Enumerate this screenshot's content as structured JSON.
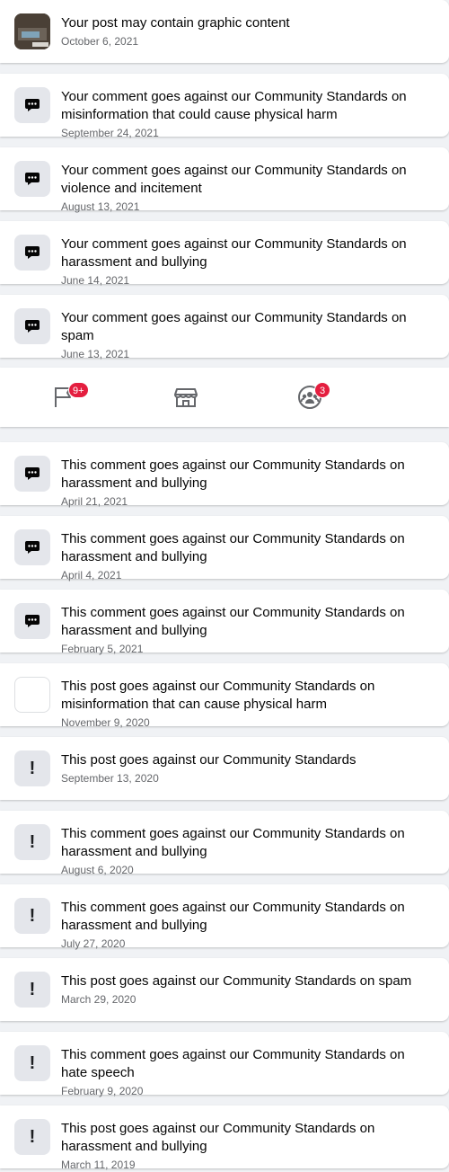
{
  "notifications_top": [
    {
      "icon": "graphic-content-photo",
      "title": "Your post may contain graphic content",
      "date": "October 6, 2021"
    },
    {
      "icon": "comment-icon",
      "title": "Your comment goes against our Community Standards on misinformation that could cause physical harm",
      "date": "September 24, 2021"
    },
    {
      "icon": "comment-icon",
      "title": "Your comment goes against our Community Standards on violence and incitement",
      "date": "August 13, 2021"
    },
    {
      "icon": "comment-icon",
      "title": "Your comment goes against our Community Standards on harassment and bullying",
      "date": "June 14, 2021"
    },
    {
      "icon": "comment-icon",
      "title": "Your comment goes against our Community Standards on spam",
      "date": "June 13, 2021"
    }
  ],
  "bottom_nav": {
    "pages_badge": "9+",
    "groups_badge": "3",
    "icons": [
      "flag-icon",
      "marketplace-icon",
      "groups-icon"
    ]
  },
  "notifications_bottom": [
    {
      "icon": "comment-icon",
      "title": "This comment goes against our Community Standards on harassment and bullying",
      "date": "April 21, 2021"
    },
    {
      "icon": "comment-icon",
      "title": "This comment goes against our Community Standards on harassment and bullying",
      "date": "April 4, 2021"
    },
    {
      "icon": "comment-icon",
      "title": "This comment goes against our Community Standards on harassment and bullying",
      "date": "February 5, 2021"
    },
    {
      "icon": "blank-thumbnail",
      "title": "This post goes against our Community Standards on misinformation that can cause physical harm",
      "date": "November 9, 2020"
    },
    {
      "icon": "exclamation-icon",
      "title": "This post goes against our Community Standards",
      "date": "September 13, 2020"
    },
    {
      "icon": "exclamation-icon",
      "title": "This comment goes against our Community Standards on harassment and bullying",
      "date": "August 6, 2020"
    },
    {
      "icon": "exclamation-icon",
      "title": "This comment goes against our Community Standards on harassment and bullying",
      "date": "July 27, 2020"
    },
    {
      "icon": "exclamation-icon",
      "title": "This post goes against our Community Standards on spam",
      "date": "March 29, 2020"
    },
    {
      "icon": "exclamation-icon",
      "title": "This comment goes against our Community Standards on hate speech",
      "date": "February 9, 2020"
    },
    {
      "icon": "exclamation-icon",
      "title": "This post goes against our Community Standards on harassment and bullying",
      "date": "March 11, 2019"
    }
  ]
}
